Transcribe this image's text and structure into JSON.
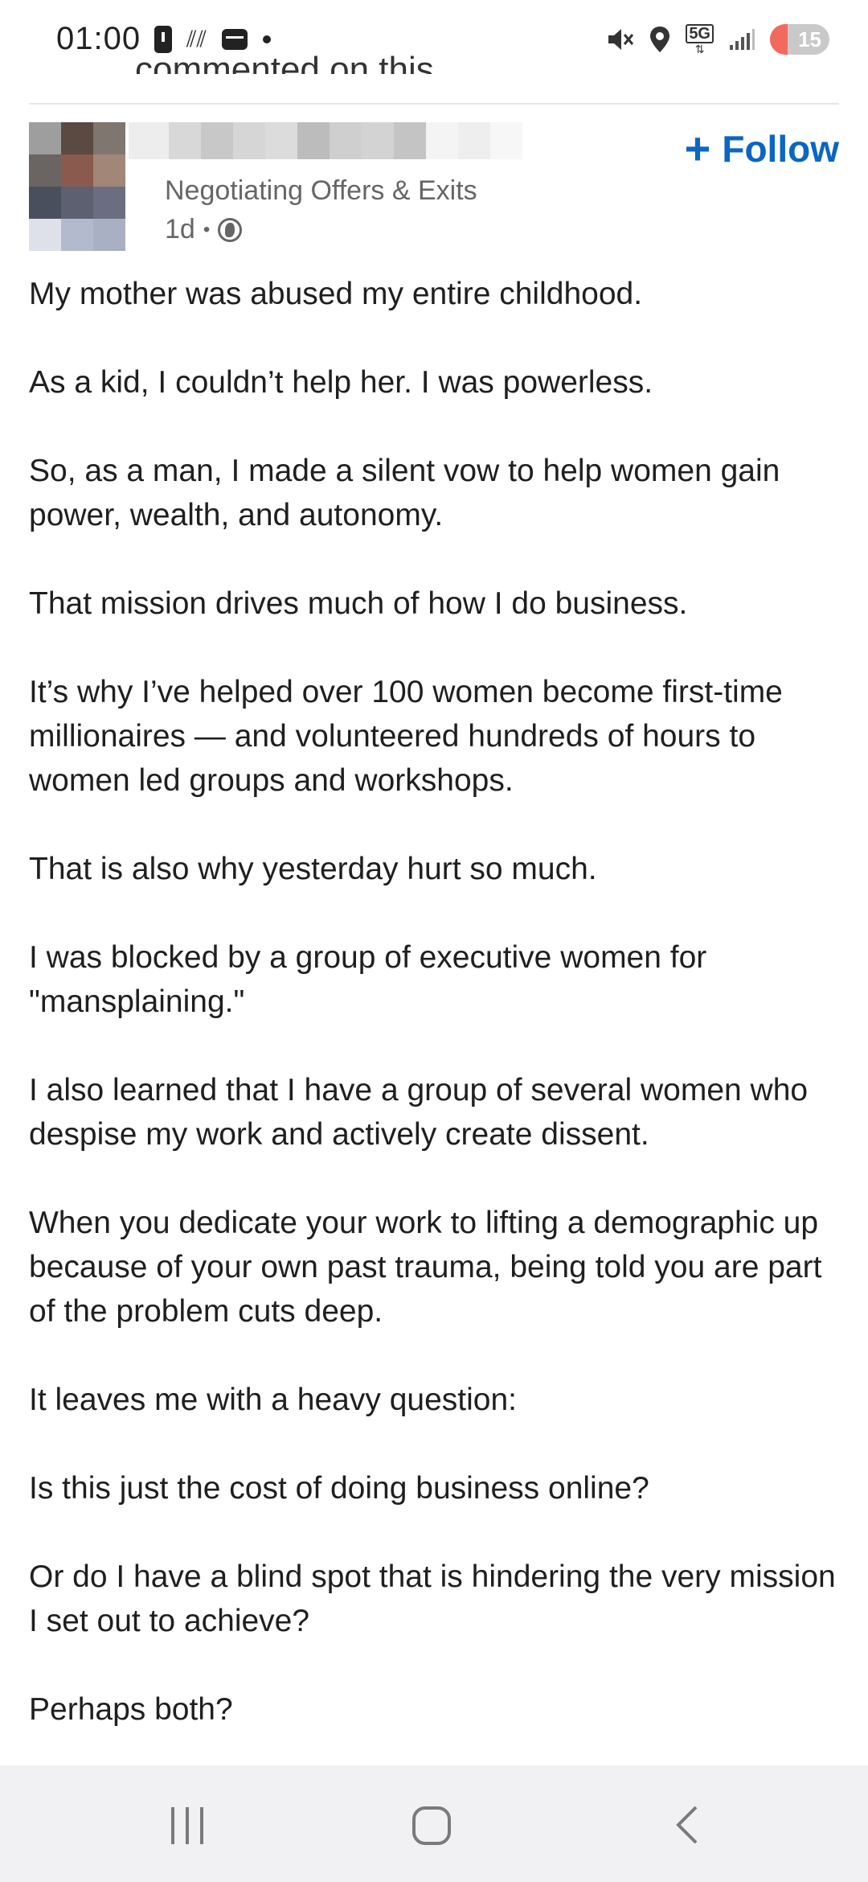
{
  "status_bar": {
    "time": "01:00",
    "icons": [
      "battery-saver-icon",
      "wifi-calling-icon",
      "message-icon",
      "notification-dot-icon",
      "mute-icon",
      "location-icon",
      "5g-icon",
      "signal-icon",
      "battery-icon"
    ],
    "network_label": "5G",
    "battery_level": "15",
    "colors": {
      "battery_bg": "#c9c9c9",
      "battery_low": "#f26a5f"
    }
  },
  "header": {
    "previous_line": "commented on this"
  },
  "post": {
    "author_subtitle": "Negotiating Offers & Exits",
    "time_ago": "1d",
    "time_separator": "•",
    "visibility_icon": "globe-icon",
    "follow_label": "Follow",
    "follow_icon": "plus-icon",
    "accent_color": "#0a66c2",
    "paragraphs": [
      "My mother was abused my entire childhood.",
      "As a kid, I couldn’t help her. I was powerless.",
      "So, as a man, I made a silent vow to help women gain power, wealth, and autonomy.",
      "That mission drives much of how I do business.",
      "It’s why I’ve helped over 100 women become first-time millionaires — and volunteered hundreds of hours to women led groups and workshops.",
      "That is also why yesterday hurt so much.",
      "I was blocked by a group of executive women for \"mansplaining.\"",
      "I also learned that I have a group of several women who despise my work and actively create dissent.",
      "When you dedicate your work to lifting a demographic up because of your own past trauma, being told you are part of the problem cuts deep.",
      "It leaves me with a heavy question:",
      "Is this just the cost of doing business online?",
      "Or do I have a blind spot that is hindering the very mission I set out to achieve?",
      "Perhaps both?"
    ]
  },
  "nav_bar": {
    "buttons": [
      "recents-icon",
      "home-icon",
      "back-icon"
    ]
  }
}
